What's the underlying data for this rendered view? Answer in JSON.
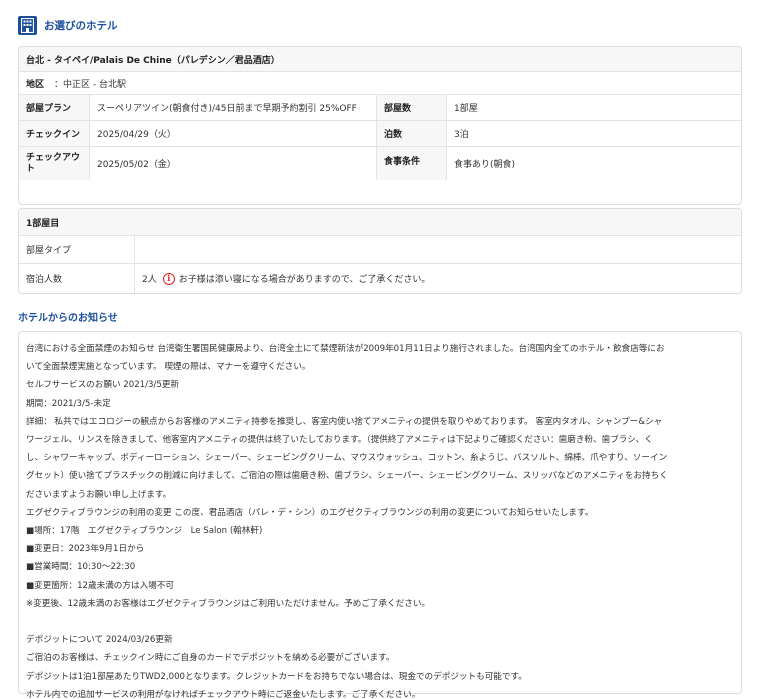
{
  "section": {
    "title": "お選びのホテル",
    "icon": "hotel-building-icon"
  },
  "hotel": {
    "name": "台北 - タイペイ/Palais De Chine（パレデシン／君品酒店）",
    "area_label": "地区",
    "area_value": "：中正区 - 台北駅",
    "plan_label": "部屋プラン",
    "plan_value": "スーペリアツイン(朝食付き)/45日前まで早期予約割引 25%OFF",
    "rooms_label": "部屋数",
    "rooms_value": "1部屋",
    "checkin_label": "チェックイン",
    "checkin_value": "2025/04/29（火）",
    "nights_label": "泊数",
    "nights_value": "3泊",
    "checkout_label_1": "チェックアウ",
    "checkout_label_2": "ト",
    "checkout_value": "2025/05/02（金）",
    "meal_label": "食事条件",
    "meal_value": "食事あり(朝食)"
  },
  "room1": {
    "title": "1部屋目",
    "type_label": "部屋タイプ",
    "type_value": "",
    "guests_label": "宿泊人数",
    "guests_value": "2人",
    "guests_note": "お子様は添い寝になる場合がありますので、ご了承ください。",
    "info_icon": "info-icon"
  },
  "notice": {
    "title": "ホテルからのお知らせ",
    "lines": [
      "台湾における全面禁煙のお知らせ 台湾衛生署国民健康局より、台湾全土にて禁煙新法が2009年01月11日より施行されました。台湾国内全てのホテル・飲食店等にお",
      "いて全面禁煙実施となっています。 喫煙の際は、マナーを遵守ください。",
      "セルフサービスのお願い 2021/3/5更新",
      "期間：2021/3/5-未定",
      "詳細： 私共ではエコロジーの観点からお客様のアメニティ持参を推奨し、客室内使い捨てアメニティの提供を取りやめております。 客室内タオル、シャンプー&シャ",
      "ワージェル、リンスを除きまして、他客室内アメニティの提供は終了いたしております。（提供終了アメニティは下記よりご確認ください：歯磨き粉、歯ブラシ、く",
      "し、シャワーキャップ、ボディーローション、シェーバー、シェービングクリーム、マウスウォッシュ、コットン、糸ようじ、バスソルト、綿棒、爪やすり、ソーイン",
      "グセット）使い捨てプラスチックの削減に向けまして、ご宿泊の際は歯磨き粉、歯ブラシ、シェーバー、シェービングクリーム、スリッパなどのアメニティをお持ちく",
      "ださいますようお願い申し上げます。",
      "エグゼクティブラウンジの利用の変更 この度、君品酒店（パレ・デ・シン）のエグゼクティブラウンジの利用の変更についてお知らせいたします。",
      "■場所：17階　エグゼクティブラウンジ　Le Salon (翰林軒)",
      "■変更日：2023年9月1日から",
      "■営業時間：10:30～22:30",
      "■変更箇所：12歳未満の方は入場不可",
      "※変更後、12歳未満のお客様はエグゼクティブラウンジはご利用いただけません。予めご了承ください。",
      "",
      "デポジットについて 2024/03/26更新",
      "ご宿泊のお客様は、チェックイン時にご自身のカードでデポジットを納める必要がございます。",
      "デポジットは1泊1部屋あたりTWD2,000となります。クレジットカードをお持ちでない場合は、現金でのデポジットも可能です。",
      "ホテル内での追加サービスの利用がなければチェックアウト時にご返金いたします。ご了承ください。"
    ]
  },
  "colors": {
    "accent": "#1b4f9c",
    "warning": "#dd2222"
  }
}
